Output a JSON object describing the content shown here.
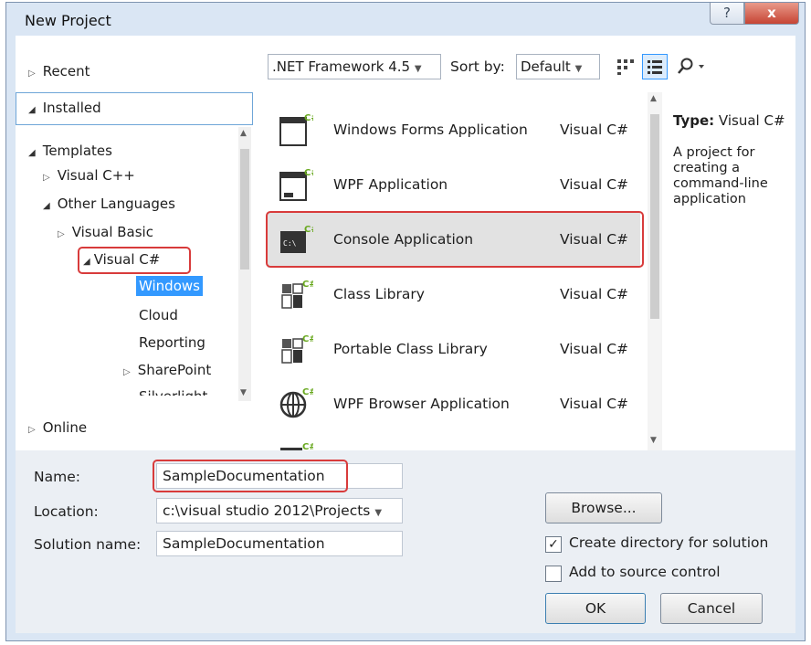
{
  "window": {
    "title": "New Project",
    "help_label": "?",
    "close_label": "x"
  },
  "left_tree": {
    "recent": "Recent",
    "installed": "Installed",
    "templates": "Templates",
    "visual_cpp": "Visual C++",
    "other_languages": "Other Languages",
    "visual_basic": "Visual Basic",
    "visual_csharp": "Visual C#",
    "windows": "Windows",
    "cloud": "Cloud",
    "reporting": "Reporting",
    "sharepoint": "SharePoint",
    "silverlight": "Silverlight",
    "online": "Online"
  },
  "toolbar": {
    "framework": ".NET Framework 4.5",
    "sort_label": "Sort by:",
    "sort_value": "Default"
  },
  "templates": [
    {
      "name": "Windows Forms Application",
      "language": "Visual C#",
      "icon": "windows-forms-icon"
    },
    {
      "name": "WPF Application",
      "language": "Visual C#",
      "icon": "wpf-application-icon"
    },
    {
      "name": "Console Application",
      "language": "Visual C#",
      "icon": "console-application-icon"
    },
    {
      "name": "Class Library",
      "language": "Visual C#",
      "icon": "class-library-icon"
    },
    {
      "name": "Portable Class Library",
      "language": "Visual C#",
      "icon": "portable-class-library-icon"
    },
    {
      "name": "WPF Browser Application",
      "language": "Visual C#",
      "icon": "wpf-browser-icon"
    }
  ],
  "details": {
    "type_label": "Type:",
    "type_value": "Visual C#",
    "description": "A project for creating a command-line application"
  },
  "form": {
    "name_label": "Name:",
    "name_value": "SampleDocumentation",
    "location_label": "Location:",
    "location_value": "c:\\visual studio 2012\\Projects",
    "solution_label": "Solution name:",
    "solution_value": "SampleDocumentation",
    "browse_label": "Browse...",
    "create_dir_label": "Create directory for solution",
    "create_dir_checked": "✓",
    "source_control_label": "Add to source control",
    "ok_label": "OK",
    "cancel_label": "Cancel"
  }
}
